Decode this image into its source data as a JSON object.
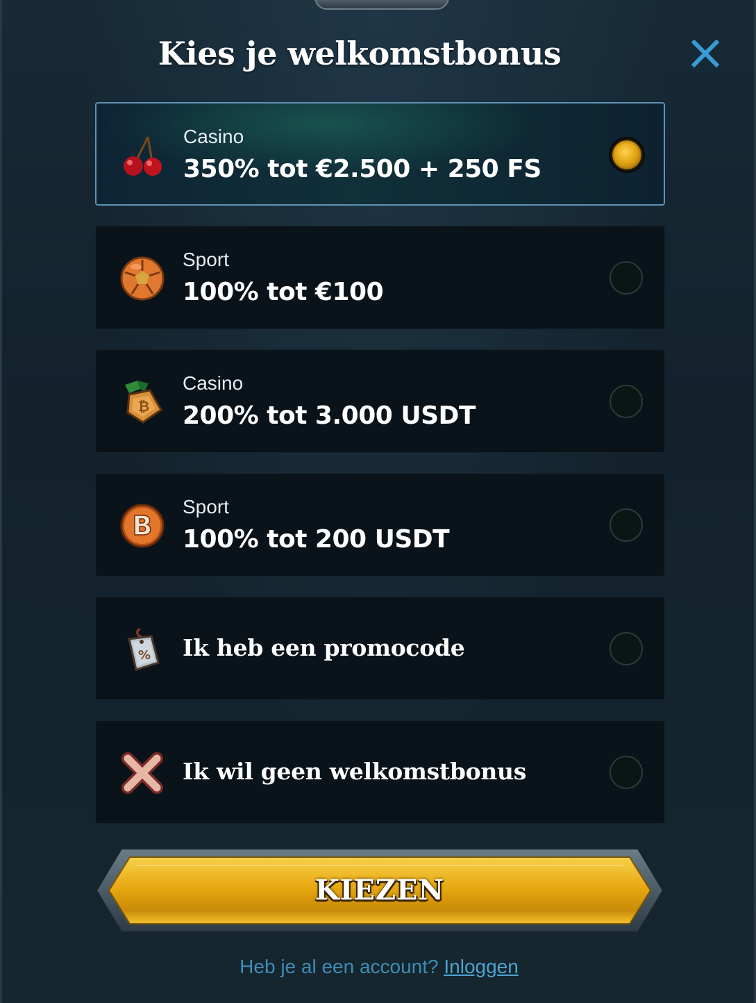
{
  "modal": {
    "title": "Kies je welkomstbonus",
    "close_icon": "close-icon"
  },
  "options": [
    {
      "icon": "cherries-icon",
      "category": "Casino",
      "amount": "350% tot €2.500 + 250 FS",
      "selected": true
    },
    {
      "icon": "football-icon",
      "category": "Sport",
      "amount": "100% tot €100",
      "selected": false
    },
    {
      "icon": "bitcoin-medal-icon",
      "category": "Casino",
      "amount": "200% tot 3.000 USDT",
      "selected": false
    },
    {
      "icon": "bitcoin-coin-icon",
      "category": "Sport",
      "amount": "100% tot 200 USDT",
      "selected": false
    },
    {
      "icon": "promo-tag-icon",
      "label": "Ik heb een promocode",
      "selected": false
    },
    {
      "icon": "cross-icon",
      "label": "Ik wil geen welkomstbonus",
      "selected": false
    }
  ],
  "cta": {
    "label": "KIEZEN"
  },
  "footer": {
    "question": "Heb je al een account?",
    "login_link": "Inloggen"
  },
  "colors": {
    "accent_gold": "#e2a414",
    "selected_border": "#5f93b4",
    "link_blue": "#4ea3d2",
    "close_blue": "#3a9bd6"
  }
}
